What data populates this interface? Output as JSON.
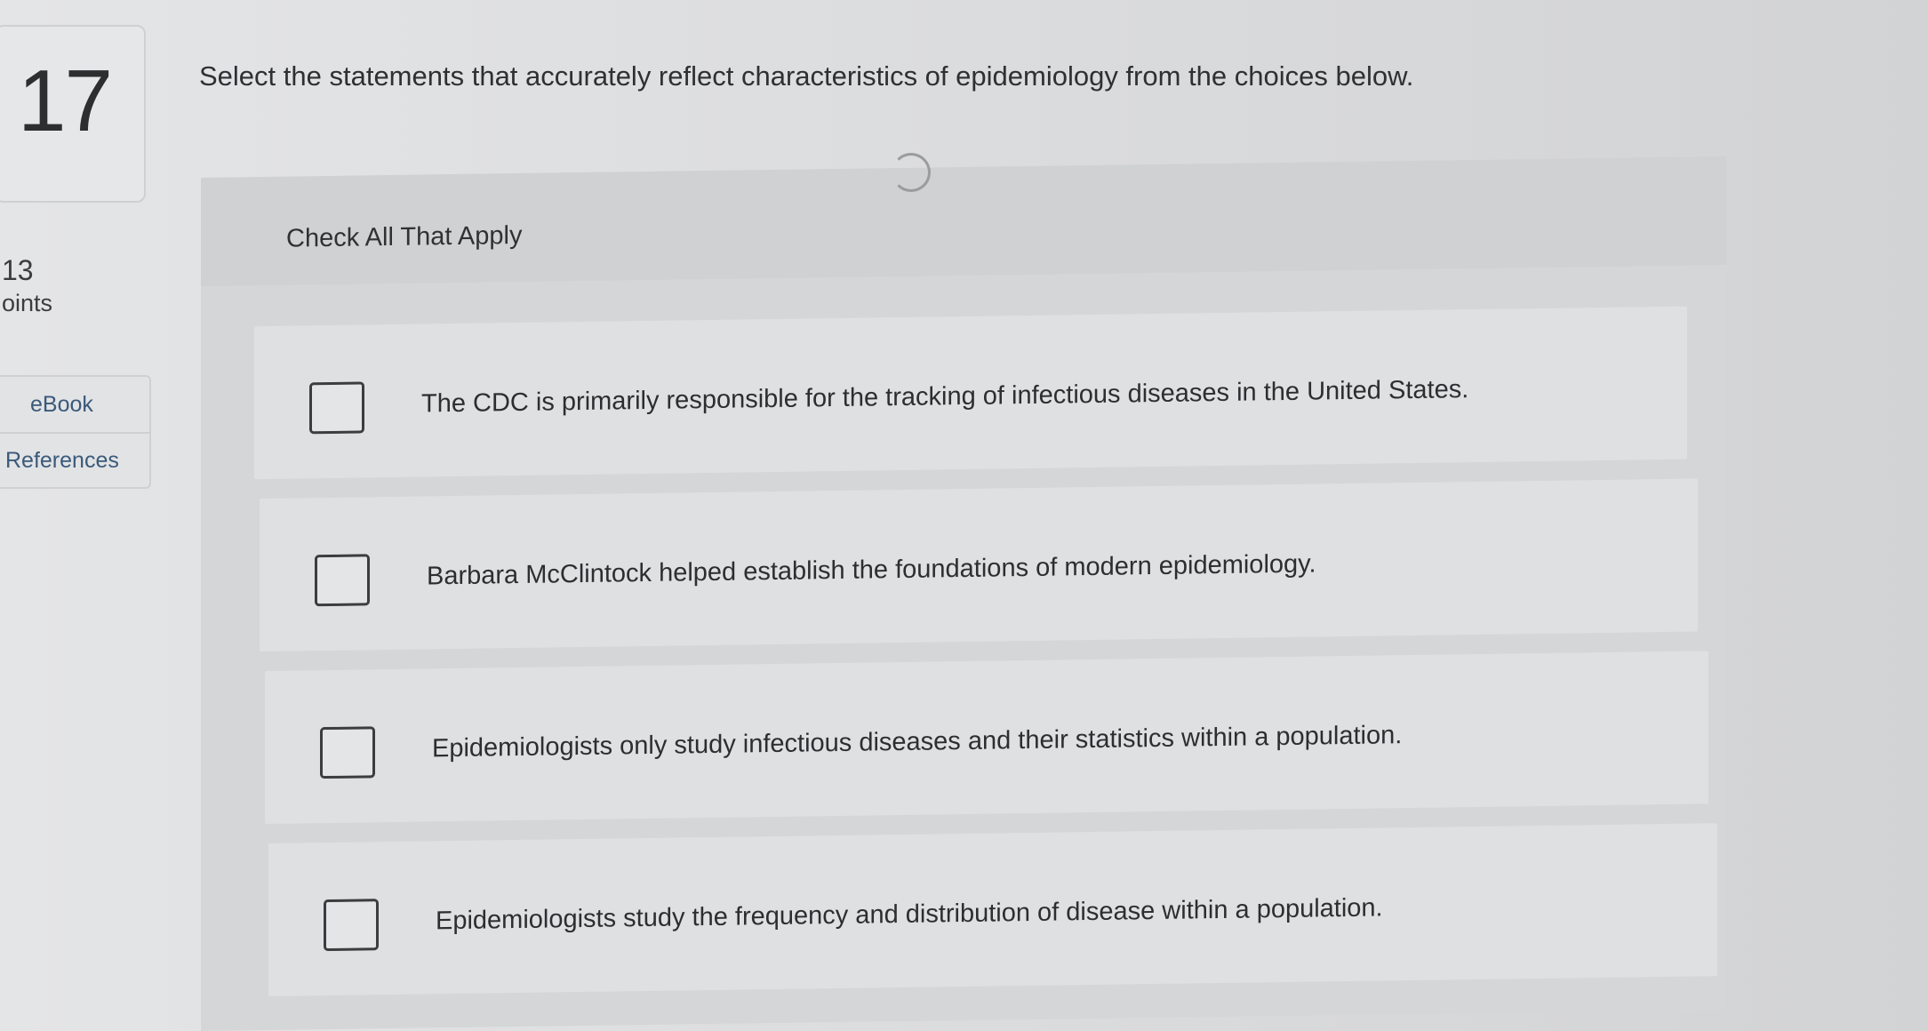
{
  "question": {
    "number": "17",
    "points_value": "13",
    "points_label": "oints",
    "prompt": "Select the statements that accurately reflect characteristics of epidemiology from the choices below."
  },
  "side_links": [
    {
      "label": "eBook"
    },
    {
      "label": "References"
    }
  ],
  "panel": {
    "title": "Check All That Apply"
  },
  "options": [
    {
      "text": "The CDC is primarily responsible for the tracking of infectious diseases in the United States.",
      "checked": false
    },
    {
      "text": "Barbara McClintock helped establish the foundations of modern epidemiology.",
      "checked": false
    },
    {
      "text": "Epidemiologists only study infectious diseases and their statistics within a population.",
      "checked": false
    },
    {
      "text": "Epidemiologists study the frequency and distribution of disease within a population.",
      "checked": false
    }
  ]
}
